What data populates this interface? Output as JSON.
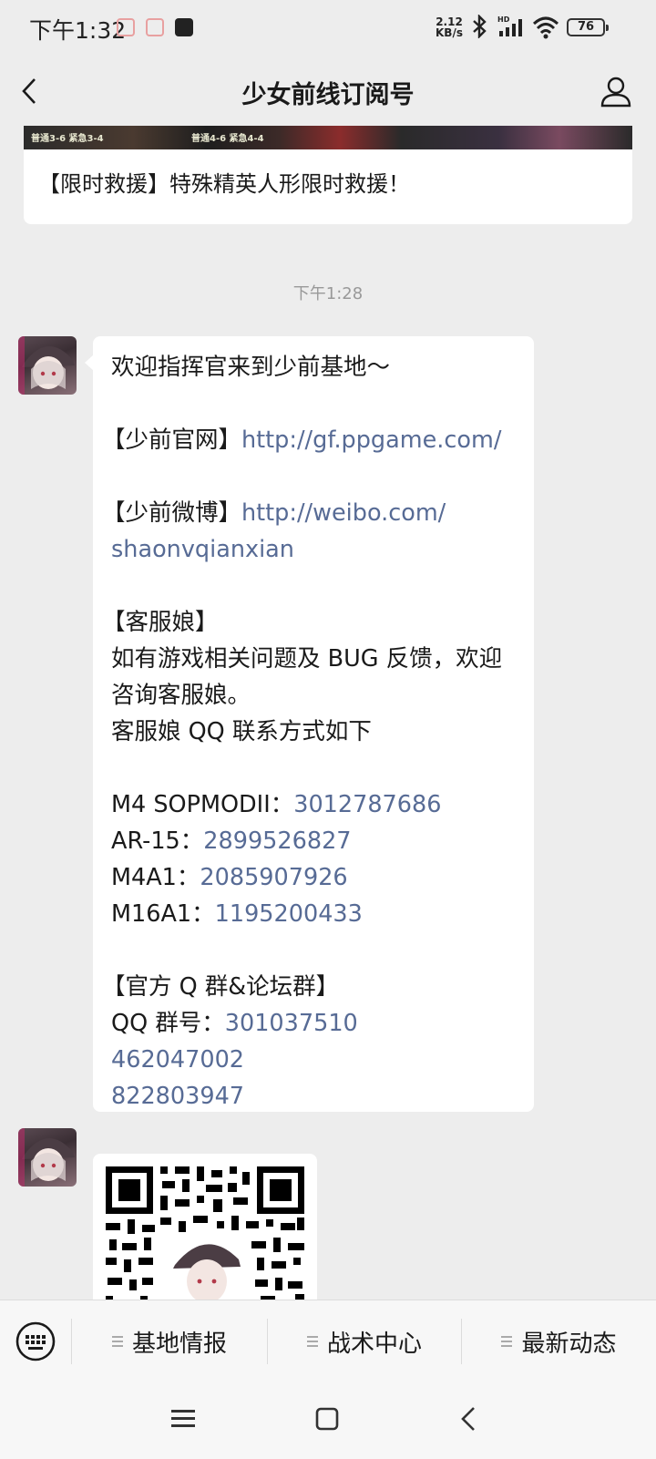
{
  "status_bar": {
    "time": "下午1:32",
    "net_speed_value": "2.12",
    "net_speed_unit": "KB/s",
    "battery": "76"
  },
  "nav": {
    "title": "少女前线订阅号"
  },
  "article": {
    "banner_tags": [
      "普通3-6 紧急3-4",
      "普通4-6 紧急4-4"
    ],
    "headline": "【限时救援】特殊精英人形限时救援！"
  },
  "timestamp": "下午1:28",
  "message": {
    "welcome": "欢迎指挥官来到少前基地～",
    "site_label": "【少前官网】",
    "site_link": "http://gf.ppgame.com/",
    "weibo_label": "【少前微博】",
    "weibo_link_1": "http://weibo.com/",
    "weibo_link_2": "shaonvqianxian",
    "service_label": "【客服娘】",
    "service_line_1": "如有游戏相关问题及 BUG 反馈，欢迎",
    "service_line_2": "咨询客服娘。",
    "service_line_3": "客服娘 QQ 联系方式如下",
    "contacts": [
      {
        "name": "M4 SOPMODII：",
        "qq": "3012787686"
      },
      {
        "name": "AR-15：",
        "qq": "2899526827"
      },
      {
        "name": "M4A1：",
        "qq": "2085907926"
      },
      {
        "name": "M16A1：",
        "qq": "1195200433"
      }
    ],
    "group_label": "【官方 Q 群&论坛群】",
    "group_prefix": "QQ 群号：",
    "groups": [
      "301037510",
      "462047002",
      "822803947"
    ]
  },
  "menu": {
    "items": [
      {
        "label": "基地情报"
      },
      {
        "label": "战术中心"
      },
      {
        "label": "最新动态"
      }
    ]
  }
}
